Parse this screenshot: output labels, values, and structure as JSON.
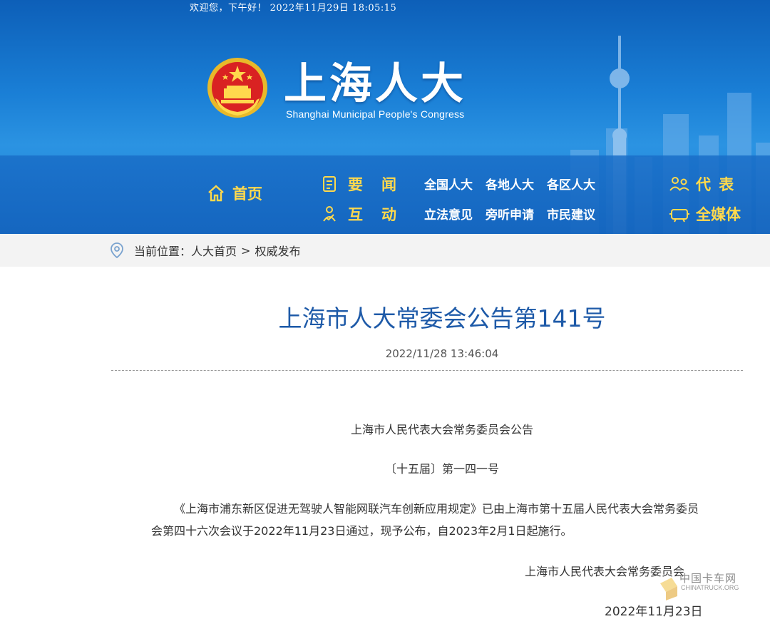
{
  "header": {
    "greeting": "欢迎您，下午好！ 2022年11月29日 18:05:15",
    "site_title": "上海人大",
    "site_subtitle": "Shanghai Municipal People's Congress"
  },
  "nav": {
    "home_label": "首页",
    "row1": {
      "category": "要闻",
      "links": [
        "全国人大",
        "各地人大",
        "各区人大"
      ],
      "right": "代 表"
    },
    "row2": {
      "category": "互动",
      "links": [
        "立法意见",
        "旁听申请",
        "市民建议"
      ],
      "right": "全媒体"
    }
  },
  "breadcrumb": {
    "prefix": "当前位置：",
    "items": [
      "人大首页",
      "权威发布"
    ],
    "separator": ">"
  },
  "article": {
    "title": "上海市人大常委会公告第141号",
    "publish_time": "2022/11/28 13:46:04",
    "issuer_heading": "上海市人民代表大会常务委员会公告",
    "number": "〔十五届〕第一四一号",
    "body": "《上海市浦东新区促进无驾驶人智能网联汽车创新应用规定》已由上海市第十五届人民代表大会常务委员会第四十六次会议于2022年11月23日通过，现予公布，自2023年2月1日起施行。",
    "signer": "上海市人民代表大会常务委员会",
    "sign_date": "2022年11月23日"
  },
  "watermark": {
    "cn": "中国卡车网",
    "en": "CHINATRUCK.ORG"
  },
  "colors": {
    "header_blue": "#1a7fd6",
    "nav_yellow": "#ffd94d",
    "title_blue": "#1e5aa8"
  }
}
